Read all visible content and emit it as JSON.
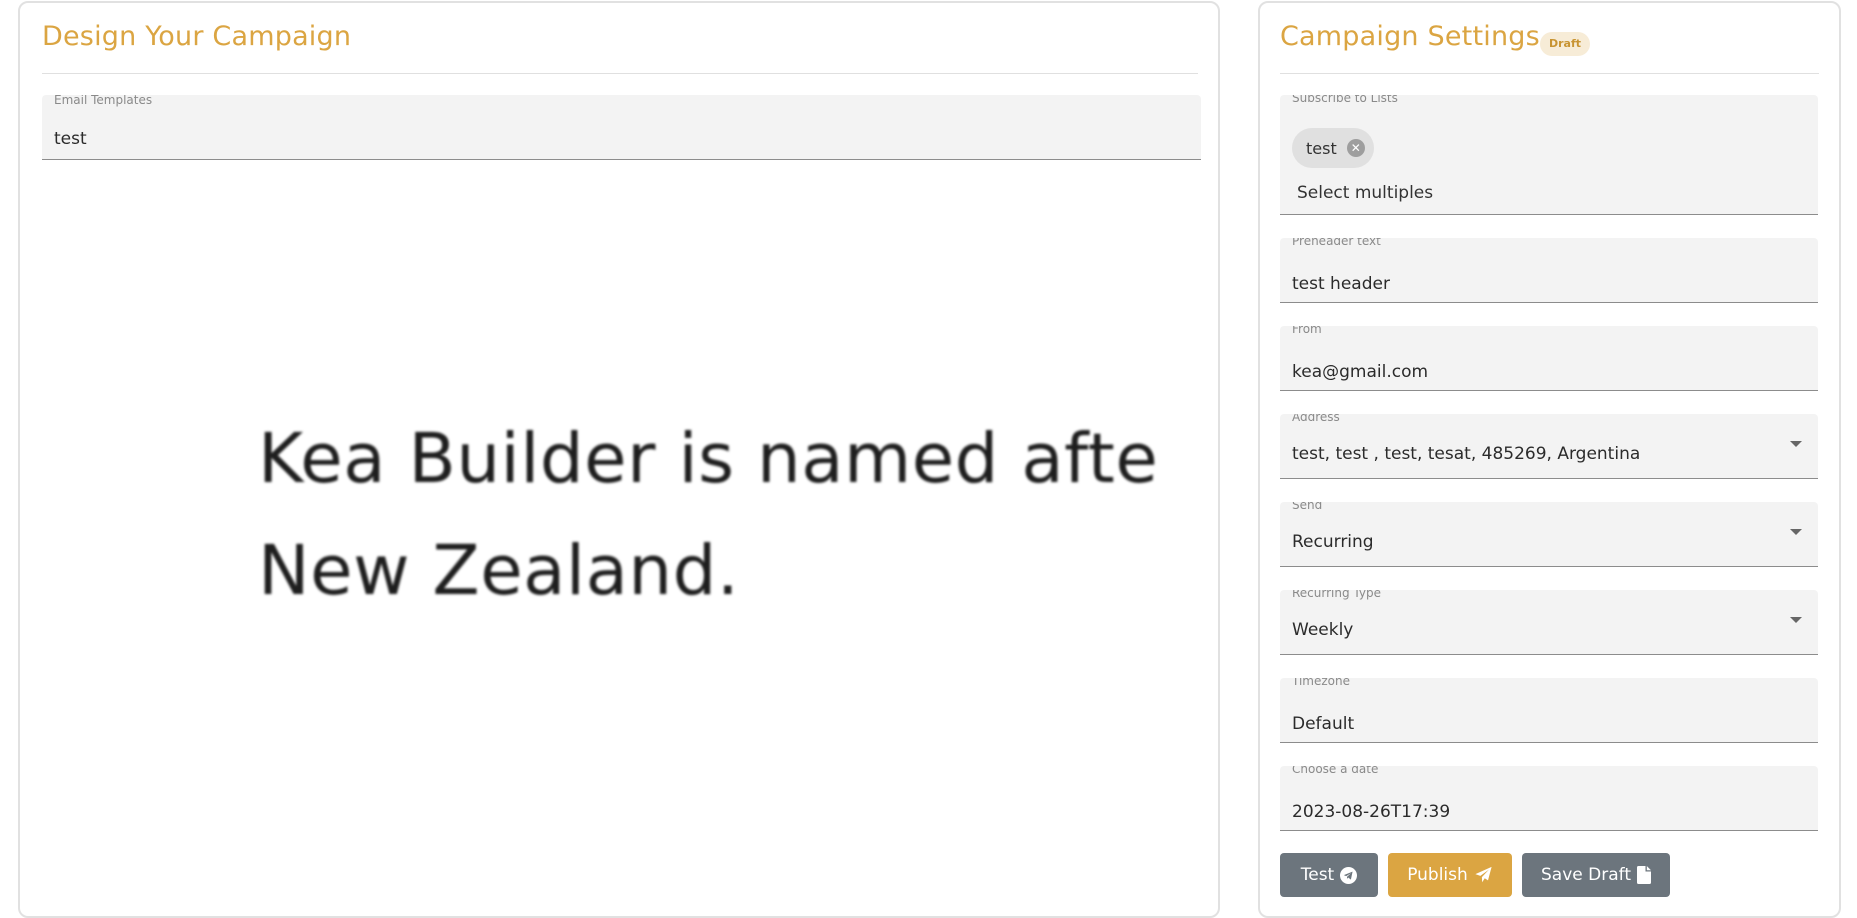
{
  "design": {
    "title": "Design Your Campaign",
    "template_field": {
      "label": "Email Templates",
      "value": "test"
    },
    "preview_text": "Kea Builder is named afte\nNew Zealand."
  },
  "settings": {
    "title": "Campaign Settings",
    "status_badge": "Draft",
    "lists_field": {
      "label": "Subscribe to Lists",
      "chips": [
        "test"
      ],
      "placeholder": "Select multiples"
    },
    "preheader_field": {
      "label": "Preheader text",
      "value": "test header"
    },
    "from_field": {
      "label": "From",
      "value": "kea@gmail.com"
    },
    "address_field": {
      "label": "Address",
      "value": "test, test , test, tesat, 485269, Argentina"
    },
    "send_field": {
      "label": "Send",
      "value": "Recurring"
    },
    "recurring_type_field": {
      "label": "Recurring Type",
      "value": "Weekly"
    },
    "timezone_field": {
      "label": "Timezone",
      "value": "Default"
    },
    "date_field": {
      "label": "Choose a date",
      "value": "2023-08-26T17:39"
    }
  },
  "actions": {
    "test_label": "Test",
    "publish_label": "Publish",
    "save_draft_label": "Save Draft",
    "test_icon": "telegram-icon",
    "publish_icon": "paper-plane-icon",
    "save_icon": "file-icon"
  },
  "colors": {
    "accent": "#dba542",
    "button_secondary": "#6c757d",
    "badge_bg": "#f7ecd7"
  }
}
